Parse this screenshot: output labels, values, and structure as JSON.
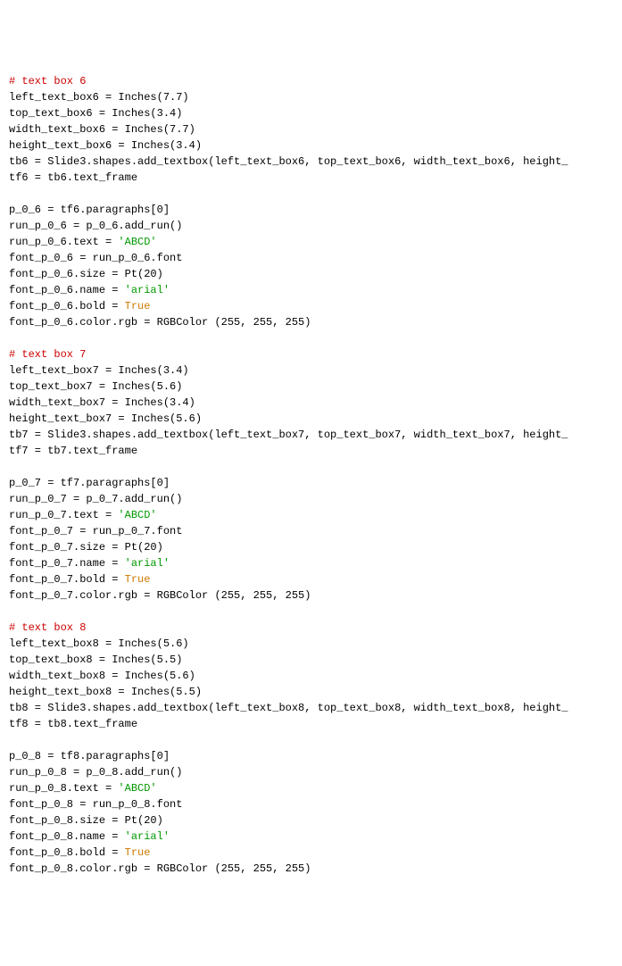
{
  "lines": [
    {
      "t": "comment",
      "v": "# text box 6"
    },
    {
      "t": "plain",
      "v": "left_text_box6 = Inches(7.7)"
    },
    {
      "t": "plain",
      "v": "top_text_box6 = Inches(3.4)"
    },
    {
      "t": "plain",
      "v": "width_text_box6 = Inches(7.7)"
    },
    {
      "t": "plain",
      "v": "height_text_box6 = Inches(3.4)"
    },
    {
      "t": "plain",
      "v": "tb6 = Slide3.shapes.add_textbox(left_text_box6, top_text_box6, width_text_box6, height_"
    },
    {
      "t": "plain",
      "v": "tf6 = tb6.text_frame"
    },
    {
      "t": "blank",
      "v": ""
    },
    {
      "t": "plain",
      "v": "p_0_6 = tf6.paragraphs[0]"
    },
    {
      "t": "plain",
      "v": "run_p_0_6 = p_0_6.add_run()"
    },
    {
      "t": "assign_str",
      "pre": "run_p_0_6.text = ",
      "str": "'ABCD'"
    },
    {
      "t": "plain",
      "v": "font_p_0_6 = run_p_0_6.font"
    },
    {
      "t": "plain",
      "v": "font_p_0_6.size = Pt(20)"
    },
    {
      "t": "assign_str",
      "pre": "font_p_0_6.name = ",
      "str": "'arial'"
    },
    {
      "t": "assign_const",
      "pre": "font_p_0_6.bold = ",
      "const": "True"
    },
    {
      "t": "plain",
      "v": "font_p_0_6.color.rgb = RGBColor (255, 255, 255)"
    },
    {
      "t": "blank",
      "v": ""
    },
    {
      "t": "comment",
      "v": "# text box 7"
    },
    {
      "t": "plain",
      "v": "left_text_box7 = Inches(3.4)"
    },
    {
      "t": "plain",
      "v": "top_text_box7 = Inches(5.6)"
    },
    {
      "t": "plain",
      "v": "width_text_box7 = Inches(3.4)"
    },
    {
      "t": "plain",
      "v": "height_text_box7 = Inches(5.6)"
    },
    {
      "t": "plain",
      "v": "tb7 = Slide3.shapes.add_textbox(left_text_box7, top_text_box7, width_text_box7, height_"
    },
    {
      "t": "plain",
      "v": "tf7 = tb7.text_frame"
    },
    {
      "t": "blank",
      "v": ""
    },
    {
      "t": "plain",
      "v": "p_0_7 = tf7.paragraphs[0]"
    },
    {
      "t": "plain",
      "v": "run_p_0_7 = p_0_7.add_run()"
    },
    {
      "t": "assign_str",
      "pre": "run_p_0_7.text = ",
      "str": "'ABCD'"
    },
    {
      "t": "plain",
      "v": "font_p_0_7 = run_p_0_7.font"
    },
    {
      "t": "plain",
      "v": "font_p_0_7.size = Pt(20)"
    },
    {
      "t": "assign_str",
      "pre": "font_p_0_7.name = ",
      "str": "'arial'"
    },
    {
      "t": "assign_const",
      "pre": "font_p_0_7.bold = ",
      "const": "True"
    },
    {
      "t": "plain",
      "v": "font_p_0_7.color.rgb = RGBColor (255, 255, 255)"
    },
    {
      "t": "blank",
      "v": ""
    },
    {
      "t": "comment",
      "v": "# text box 8"
    },
    {
      "t": "plain",
      "v": "left_text_box8 = Inches(5.6)"
    },
    {
      "t": "plain",
      "v": "top_text_box8 = Inches(5.5)"
    },
    {
      "t": "plain",
      "v": "width_text_box8 = Inches(5.6)"
    },
    {
      "t": "plain",
      "v": "height_text_box8 = Inches(5.5)"
    },
    {
      "t": "plain",
      "v": "tb8 = Slide3.shapes.add_textbox(left_text_box8, top_text_box8, width_text_box8, height_"
    },
    {
      "t": "plain",
      "v": "tf8 = tb8.text_frame"
    },
    {
      "t": "blank",
      "v": ""
    },
    {
      "t": "plain",
      "v": "p_0_8 = tf8.paragraphs[0]"
    },
    {
      "t": "plain",
      "v": "run_p_0_8 = p_0_8.add_run()"
    },
    {
      "t": "assign_str",
      "pre": "run_p_0_8.text = ",
      "str": "'ABCD'"
    },
    {
      "t": "plain",
      "v": "font_p_0_8 = run_p_0_8.font"
    },
    {
      "t": "plain",
      "v": "font_p_0_8.size = Pt(20)"
    },
    {
      "t": "assign_str",
      "pre": "font_p_0_8.name = ",
      "str": "'arial'"
    },
    {
      "t": "assign_const",
      "pre": "font_p_0_8.bold = ",
      "const": "True"
    },
    {
      "t": "plain",
      "v": "font_p_0_8.color.rgb = RGBColor (255, 255, 255)"
    }
  ]
}
